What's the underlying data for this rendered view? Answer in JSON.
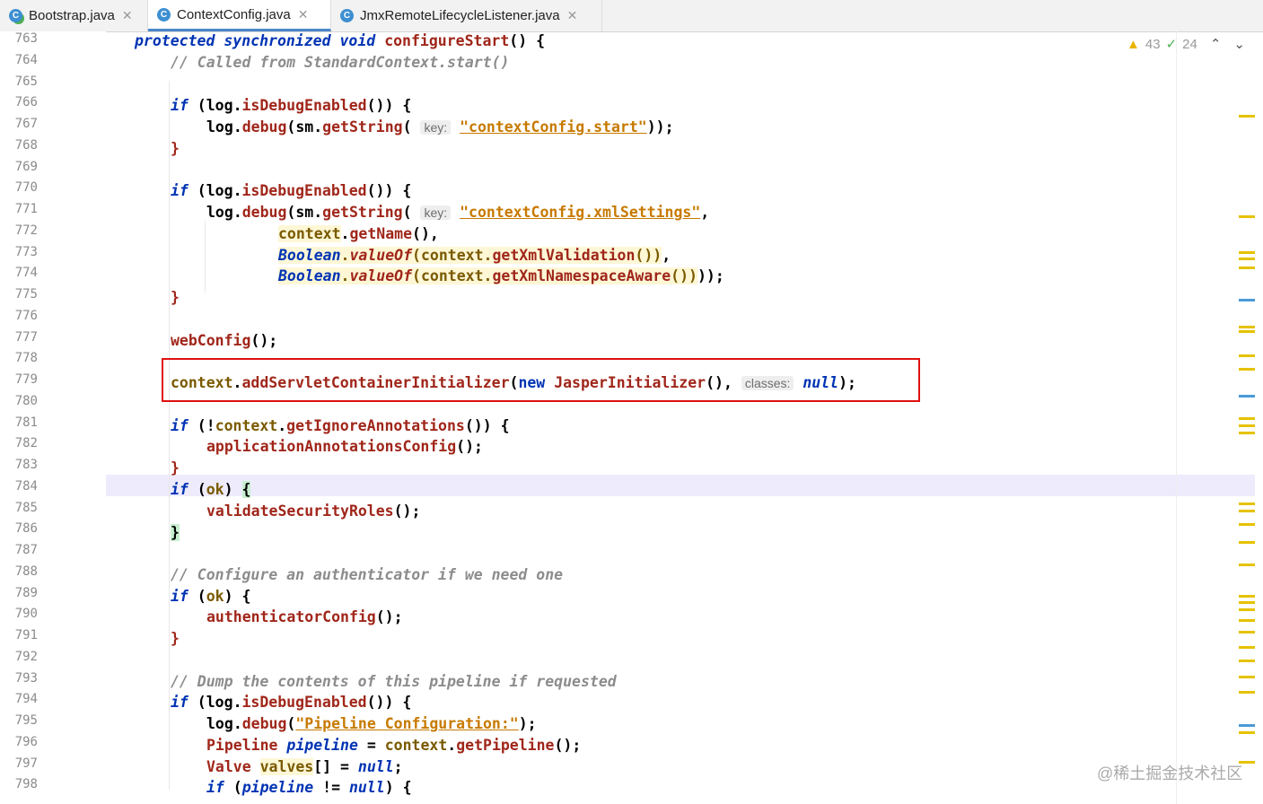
{
  "tabs": [
    {
      "label": "Bootstrap.java",
      "icon": "class-run-icon"
    },
    {
      "label": "ContextConfig.java",
      "icon": "class-icon",
      "active": true
    },
    {
      "label": "JmxRemoteLifecycleListener.java",
      "icon": "class-icon"
    }
  ],
  "status": {
    "warnings": "43",
    "checks": "24"
  },
  "line_numbers": [
    "763",
    "764",
    "765",
    "766",
    "767",
    "768",
    "769",
    "770",
    "771",
    "772",
    "773",
    "774",
    "775",
    "776",
    "777",
    "778",
    "779",
    "780",
    "781",
    "782",
    "783",
    "784",
    "785",
    "786",
    "787",
    "788",
    "789",
    "790",
    "791",
    "792",
    "793",
    "794",
    "795",
    "796",
    "797",
    "798"
  ],
  "hints": {
    "key": "key:",
    "classes": "classes:"
  },
  "watermark": "@稀土掘金技术社区"
}
